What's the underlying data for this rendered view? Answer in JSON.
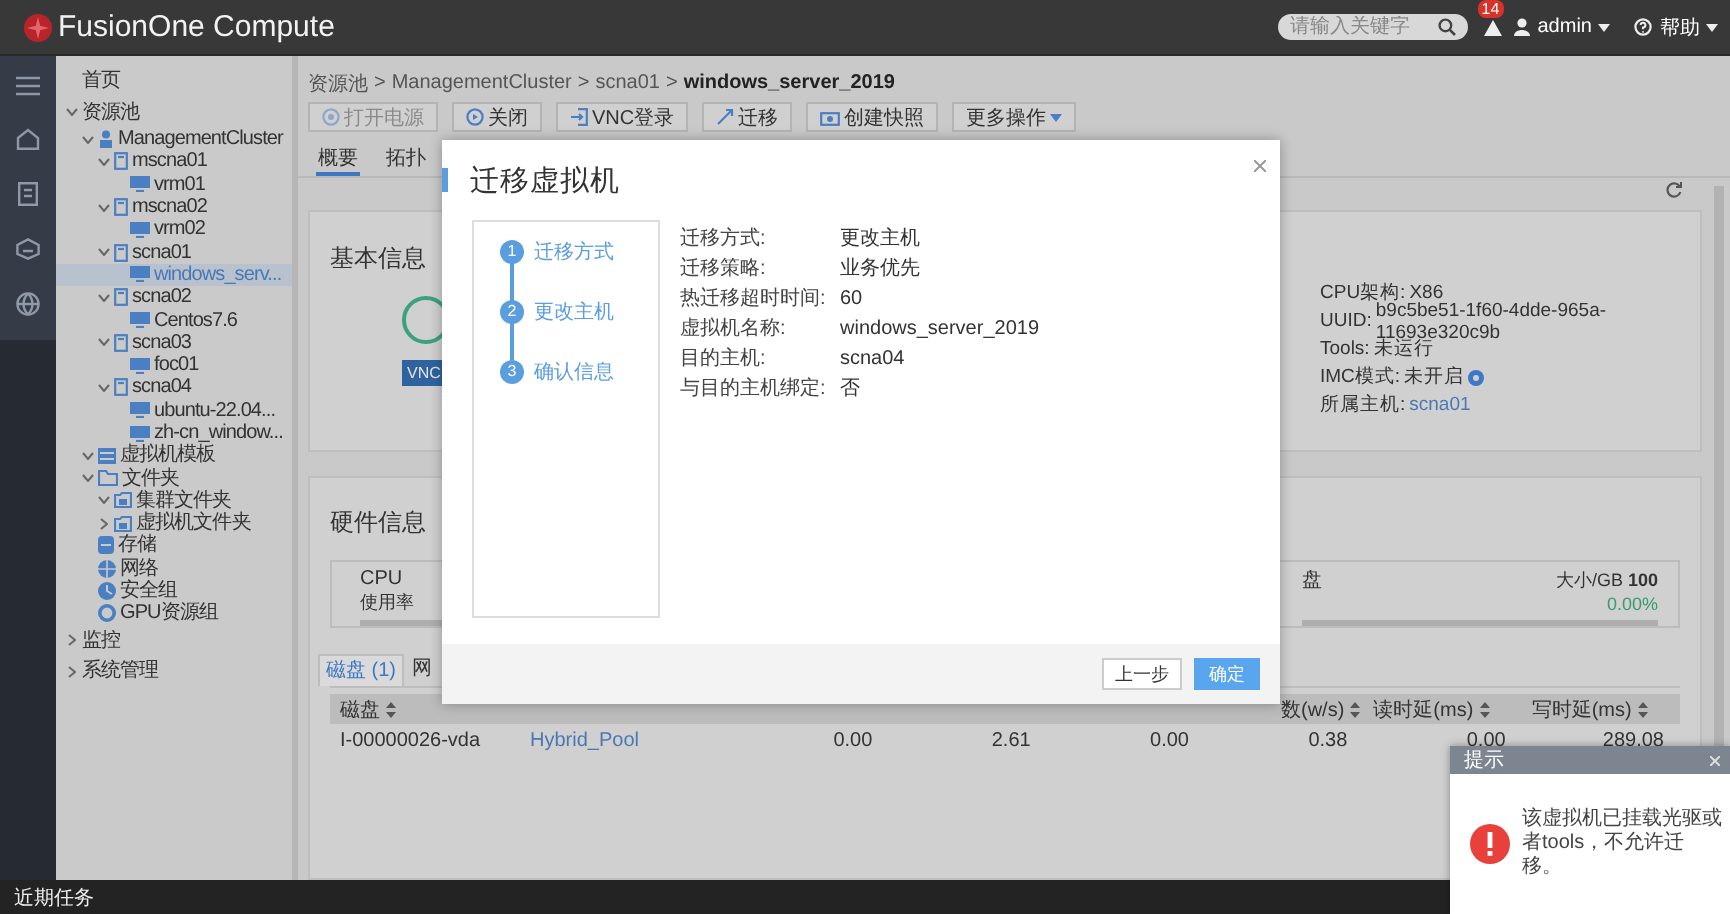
{
  "header": {
    "title": "FusionOne Compute",
    "search": {
      "placeholder": "请输入关键字"
    },
    "alarm_count": "14",
    "user": "admin",
    "help": "帮助"
  },
  "rail": [
    {
      "kind": "menu"
    },
    {
      "kind": "home"
    },
    {
      "kind": "document"
    },
    {
      "kind": "cloud"
    },
    {
      "kind": "globe"
    }
  ],
  "tree": [
    {
      "label": "首页",
      "selected": false
    },
    {
      "label": "资源池",
      "selected": false,
      "expanded": true,
      "children": [
        {
          "label": "ManagementCluster",
          "kind": "cluster",
          "selected": false,
          "expanded": true,
          "children": [
            {
              "label": "mscna01",
              "kind": "host",
              "selected": false,
              "expanded": true,
              "children": [
                {
                  "label": "vrm01",
                  "kind": "vm",
                  "selected": false
                }
              ]
            },
            {
              "label": "mscna02",
              "kind": "host",
              "selected": false,
              "expanded": true,
              "children": [
                {
                  "label": "vrm02",
                  "kind": "vm",
                  "selected": false
                }
              ]
            },
            {
              "label": "scna01",
              "kind": "host",
              "selected": false,
              "expanded": true,
              "children": [
                {
                  "label": "windows_serv...",
                  "kind": "vm",
                  "selected": true
                }
              ]
            },
            {
              "label": "scna02",
              "kind": "host",
              "selected": false,
              "expanded": true,
              "children": [
                {
                  "label": "Centos7.6",
                  "kind": "vm",
                  "selected": false
                }
              ]
            },
            {
              "label": "scna03",
              "kind": "host",
              "selected": false,
              "expanded": true,
              "children": [
                {
                  "label": "foc01",
                  "kind": "vm",
                  "selected": false
                }
              ]
            },
            {
              "label": "scna04",
              "kind": "host",
              "selected": false,
              "expanded": true,
              "children": [
                {
                  "label": "ubuntu-22.04...",
                  "kind": "vm",
                  "selected": false
                },
                {
                  "label": "zh-cn_window...",
                  "kind": "vm",
                  "selected": false
                }
              ]
            }
          ]
        },
        {
          "label": "虚拟机模板",
          "kind": "template",
          "selected": false,
          "expanded": true
        },
        {
          "label": "文件夹",
          "kind": "folder",
          "selected": false,
          "expanded": true,
          "children": [
            {
              "label": "集群文件夹",
              "kind": "subfolder",
              "selected": false,
              "expanded": true
            },
            {
              "label": "虚拟机文件夹",
              "kind": "subfolder",
              "selected": false,
              "expanded": false
            }
          ]
        },
        {
          "label": "存储",
          "kind": "storage",
          "selected": false
        },
        {
          "label": "网络",
          "kind": "network",
          "selected": false
        },
        {
          "label": "安全组",
          "kind": "security",
          "selected": false
        },
        {
          "label": "GPU资源组",
          "kind": "gpu",
          "selected": false
        }
      ]
    },
    {
      "label": "监控",
      "selected": false,
      "expanded": false
    },
    {
      "label": "系统管理",
      "selected": false,
      "expanded": false
    }
  ],
  "breadcrumb": {
    "separator": ">",
    "items": [
      "资源池",
      "ManagementCluster",
      "scna01",
      "windows_server_2019"
    ]
  },
  "toolbar": [
    {
      "label": "打开电源",
      "kind": "power-on",
      "disabled": true
    },
    {
      "label": "关闭",
      "kind": "power-off",
      "disabled": false
    },
    {
      "label": "VNC登录",
      "kind": "vnc-login",
      "disabled": false
    },
    {
      "label": "迁移",
      "kind": "migrate",
      "disabled": false
    },
    {
      "label": "创建快照",
      "kind": "snapshot",
      "disabled": false
    },
    {
      "label": "更多操作",
      "kind": "more-actions",
      "disabled": false
    }
  ],
  "tabs": [
    {
      "label": "概要",
      "selected": true
    },
    {
      "label": "拓扑",
      "selected": false
    }
  ],
  "basic_info": {
    "title": "基本信息",
    "vnc_button": "VNC",
    "fields": [
      {
        "label": "CPU架构:",
        "value": "X86",
        "kind": "text"
      },
      {
        "label": "UUID:",
        "value": "b9c5be51-1f60-4dde-965a-11693e320c9b",
        "kind": "text"
      },
      {
        "label": "Tools:",
        "value": "未运行",
        "kind": "text"
      },
      {
        "label": "IMC模式:",
        "value": "未开启",
        "kind": "info"
      },
      {
        "label": "所属主机:",
        "value": "scna01",
        "kind": "link"
      }
    ]
  },
  "hardware": {
    "title": "硬件信息",
    "cpu": {
      "name": "CPU",
      "metric": "使用率",
      "level": 0
    },
    "disk": {
      "name": "盘",
      "size_label": "大小/GB",
      "size": "100",
      "percent": "0.00%",
      "level": 0
    }
  },
  "disk_table": {
    "tabs": [
      {
        "label": "磁盘 (1)",
        "selected": true
      },
      {
        "label": "网",
        "selected": false
      }
    ],
    "columns": [
      "磁盘",
      "",
      "",
      "",
      "",
      "数(w/s)",
      "读时延(ms)",
      "写时延(ms)"
    ],
    "rows": [
      {
        "cells": [
          {
            "text": "I-00000026-vda",
            "kind": "text"
          },
          {
            "text": "Hybrid_Pool",
            "kind": "link"
          },
          {
            "text": "0.00",
            "kind": "number"
          },
          {
            "text": "2.61",
            "kind": "number"
          },
          {
            "text": "0.00",
            "kind": "number"
          },
          {
            "text": "0.38",
            "kind": "number"
          },
          {
            "text": "0.00",
            "kind": "number"
          },
          {
            "text": "289.08",
            "kind": "number"
          }
        ]
      }
    ]
  },
  "modal": {
    "title": "迁移虚拟机",
    "steps": [
      {
        "number": "1",
        "label": "迁移方式"
      },
      {
        "number": "2",
        "label": "更改主机"
      },
      {
        "number": "3",
        "label": "确认信息"
      }
    ],
    "summary": [
      {
        "label": "迁移方式:",
        "value": "更改主机"
      },
      {
        "label": "迁移策略:",
        "value": "业务优先"
      },
      {
        "label": "热迁移超时时间:",
        "value": "60"
      },
      {
        "label": "虚拟机名称:",
        "value": "windows_server_2019"
      },
      {
        "label": "目的主机:",
        "value": "scna04"
      },
      {
        "label": "与目的主机绑定:",
        "value": "否"
      }
    ],
    "buttons": [
      {
        "label": "上一步",
        "kind": "secondary"
      },
      {
        "label": "确定",
        "kind": "primary"
      }
    ]
  },
  "toast": {
    "title": "提示",
    "message": "该虚拟机已挂载光驱或者tools，不允许迁移。"
  },
  "status_bar": {
    "label": "近期任务"
  }
}
